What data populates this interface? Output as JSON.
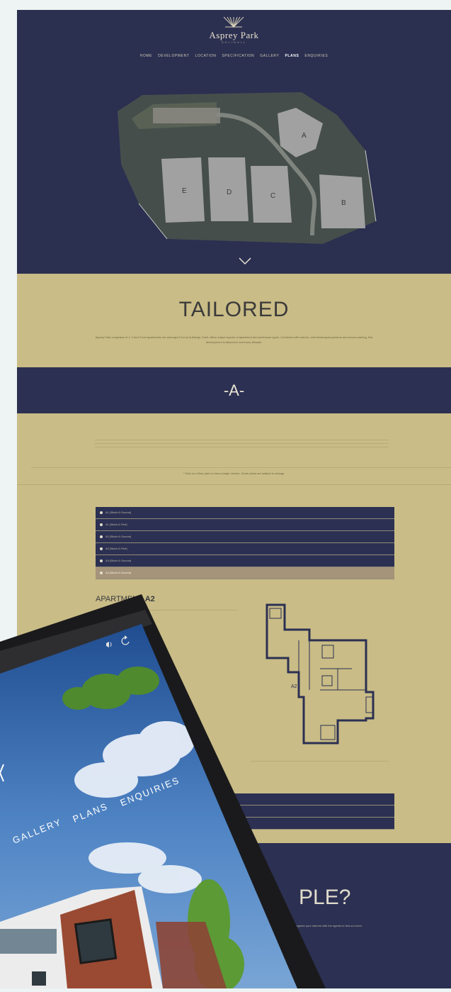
{
  "logo": {
    "name": "Asprey Park",
    "tagline": "SOLIHULL"
  },
  "nav": [
    "HOME",
    "DEVELOPMENT",
    "LOCATION",
    "SPECIFICATION",
    "GALLERY",
    "PLANS",
    "ENQUIRIES"
  ],
  "nav_active": "PLANS",
  "siteplan": {
    "blocks": [
      "A",
      "B",
      "C",
      "D",
      "E"
    ]
  },
  "intro": {
    "heading": "TAILORED",
    "text": "Asprey Park comprises of 1, 2 and 3 bed apartments set amongst 5 luxury buildings. Each offers unique layouts of apartment and penthouse types. Combined with mature, well-landscaped gardens and secure parking, this development is tailored to suit every lifestyle."
  },
  "block_header": "-A-",
  "note": "* Click on a floor plan to view a larger version. Some plans are subject to change.",
  "apartment_tabs": [
    "A1 (Block A Ground)",
    "A1 (Block A First)",
    "A2 (Block A Ground)",
    "A2 (Block A First)",
    "A3 (Block A Ground)",
    "A4 (Block A Ground)"
  ],
  "selected_tab_index": 5,
  "apartment": {
    "label": "APARTMENT ",
    "code": "A2"
  },
  "floorplan_label": "A2",
  "closing": {
    "heading": "PLE?",
    "sub": "Register your interest with the agents to find out more."
  },
  "tablet_nav": [
    "GALLERY",
    "PLANS",
    "ENQUIRIES"
  ],
  "colors": {
    "navy": "#2c3052",
    "tan": "#c9bc86",
    "selected": "#a5947a",
    "cream": "#e8e4d4"
  }
}
